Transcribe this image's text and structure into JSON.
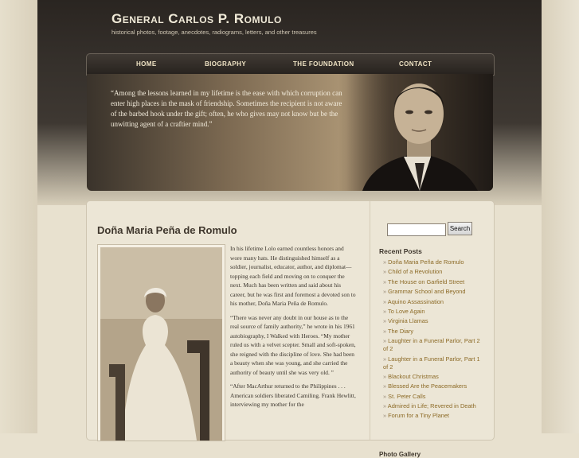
{
  "site": {
    "title": "General Carlos P. Romulo",
    "tagline": "historical photos, footage, anecdotes, radiograms, letters, and other treasures"
  },
  "nav": {
    "items": [
      {
        "label": "HOME"
      },
      {
        "label": "BIOGRAPHY"
      },
      {
        "label": "THE FOUNDATION"
      },
      {
        "label": "CONTACT"
      }
    ]
  },
  "hero": {
    "quote": "“Among the lessons learned in my lifetime is the ease with which corruption can enter high places in the mask of friendship. Sometimes the recipient is not aware of the barbed hook under the gift; often, he who gives may not know but be the unwitting agent of a craftier mind.”"
  },
  "post": {
    "title": "Doña Maria Peña de Romulo",
    "paragraphs": [
      "In his lifetime Lolo earned countless honors and wore many hats. He distinguished himself as a soldier, journalist, educator, author, and diplomat—topping each field and moving on to conquer the next. Much has been written and said about his career, but he was first and foremost a devoted son to his mother, Doña Maria Peña de Romulo.",
      "“There was never any doubt in our house as to the real source of family authority,” he wrote in his 1961 autobiography, I Walked with Heroes. “My mother ruled us with a velvet scepter. Small and soft-spoken, she reigned with the discipline of love. She had been a beauty when she was young, and she carried the authority of beauty until she was very old. ”",
      "“After MacArthur returned to the Philippines . . . American soldiers liberated Camiling. Frank Hewlitt, interviewing my mother for the"
    ]
  },
  "sidebar": {
    "search_button": "Search",
    "search_value": "",
    "recent_title": "Recent Posts",
    "recent_posts": [
      "Doña Maria Peña de Romulo",
      "Child of a Revolution",
      "The House on Garfield Street",
      "Grammar School and Beyond",
      "Aquino Assassination",
      "To Love Again",
      "Virginia Llamas",
      "The Diary",
      "Laughter in a Funeral Parlor, Part 2 of 2",
      "Laughter in a Funeral Parlor, Part 1 of 2",
      "Blackout Christmas",
      "Blessed Are the Peacemakers",
      "St. Peter Calls",
      "Admired in Life; Revered in Death",
      "Forum for a Tiny Planet"
    ],
    "next_title": "Photo Gallery"
  },
  "colors": {
    "link": "#8c6a26",
    "header_dark": "#2a2521",
    "nav_text": "#efe3c4"
  }
}
